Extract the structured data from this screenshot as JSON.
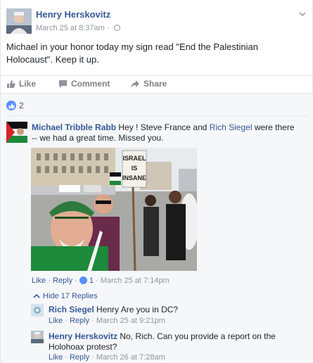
{
  "post": {
    "author": "Henry Herskovitz",
    "timestamp": "March 25 at 8:37am",
    "separator": "·",
    "text": "Michael in your honor today my sign read \"End the Palestinian Holocaust\". Keep it up."
  },
  "actions": {
    "like": "Like",
    "comment": "Comment",
    "share": "Share"
  },
  "reactions": {
    "count": "2"
  },
  "comments": [
    {
      "author": "Michael Tribble Rabb",
      "text_1": "Hey ! Steve France and ",
      "mention": "Rich Siegel",
      "text_2": " were there -- we had a great time. Missed you.",
      "photo_sign_text": "ISRAEL IS INSANE",
      "like": "Like",
      "reply": "Reply",
      "like_count": "1",
      "timestamp": "March 25 at 7:14pm"
    }
  ],
  "replies_toggle": "Hide 17 Replies",
  "replies": [
    {
      "author": "Rich Siegel",
      "text": "Henry Are you in DC?",
      "like": "Like",
      "reply": "Reply",
      "timestamp": "March 25 at 9:21pm"
    },
    {
      "author": "Henry Herskovitz",
      "text": "No, Rich. Can you provide a report on the Holohoax protest?",
      "like": "Like",
      "reply": "Reply",
      "timestamp": "March 26 at 7:28am"
    }
  ],
  "colors": {
    "link": "#365899",
    "meta": "#90949c",
    "like_blue": "#5890ff",
    "comments_bg": "#f6f7f9"
  }
}
